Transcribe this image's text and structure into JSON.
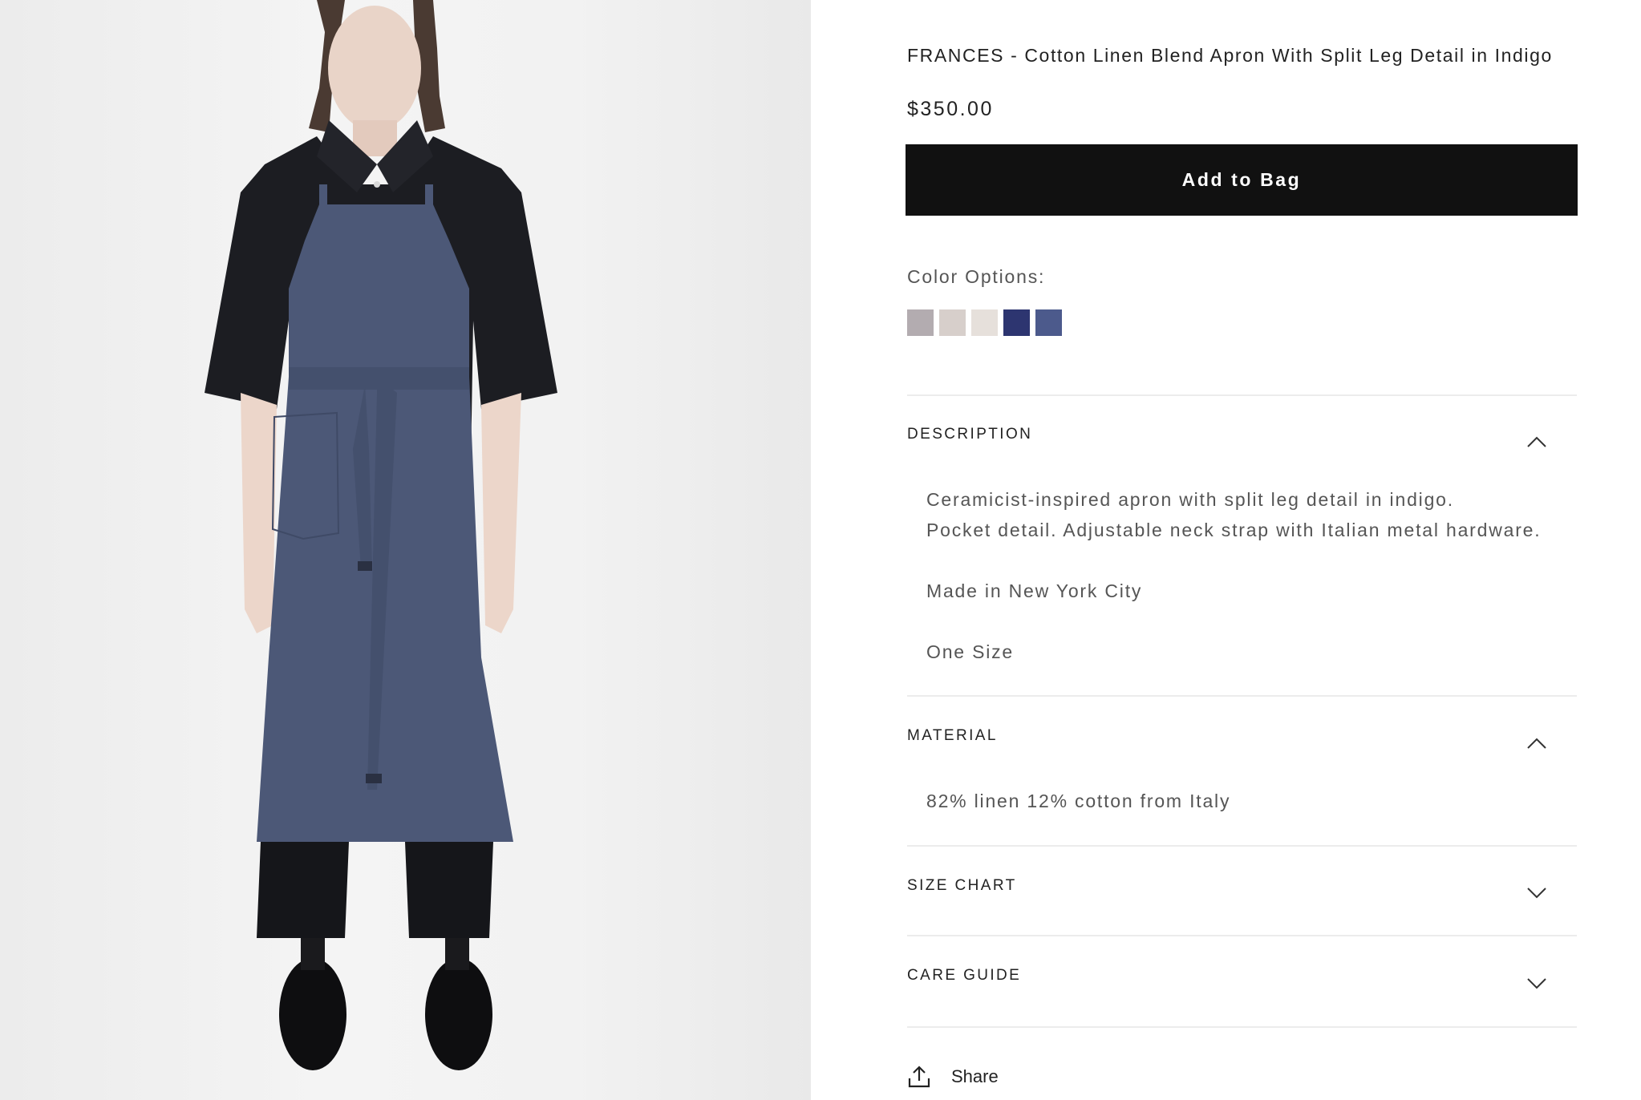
{
  "product": {
    "title": "FRANCES - Cotton Linen Blend Apron With Split Leg Detail in Indigo",
    "price": "$350.00",
    "add_to_bag_label": "Add to Bag"
  },
  "colors": {
    "label": "Color Options:",
    "swatches": [
      "#b3acb0",
      "#d7cfcb",
      "#e6e0db",
      "#2d3570",
      "#4c5a8c"
    ]
  },
  "accordions": {
    "description": {
      "title": "DESCRIPTION",
      "expanded": true,
      "lines": [
        "Ceramicist-inspired apron with split leg detail in indigo.",
        "Pocket detail. Adjustable neck strap with Italian metal hardware.",
        "Made in New York City",
        "One Size"
      ]
    },
    "material": {
      "title": "MATERIAL",
      "expanded": true,
      "lines": [
        "82% linen 12% cotton from Italy"
      ]
    },
    "size_chart": {
      "title": "SIZE CHART",
      "expanded": false
    },
    "care_guide": {
      "title": "CARE GUIDE",
      "expanded": false
    }
  },
  "share": {
    "label": "Share",
    "icon": "share-icon"
  },
  "theme": {
    "button_bg": "#111111",
    "divider": "#ececec",
    "apron": "#4c5877",
    "shirt": "#1c1d22"
  }
}
